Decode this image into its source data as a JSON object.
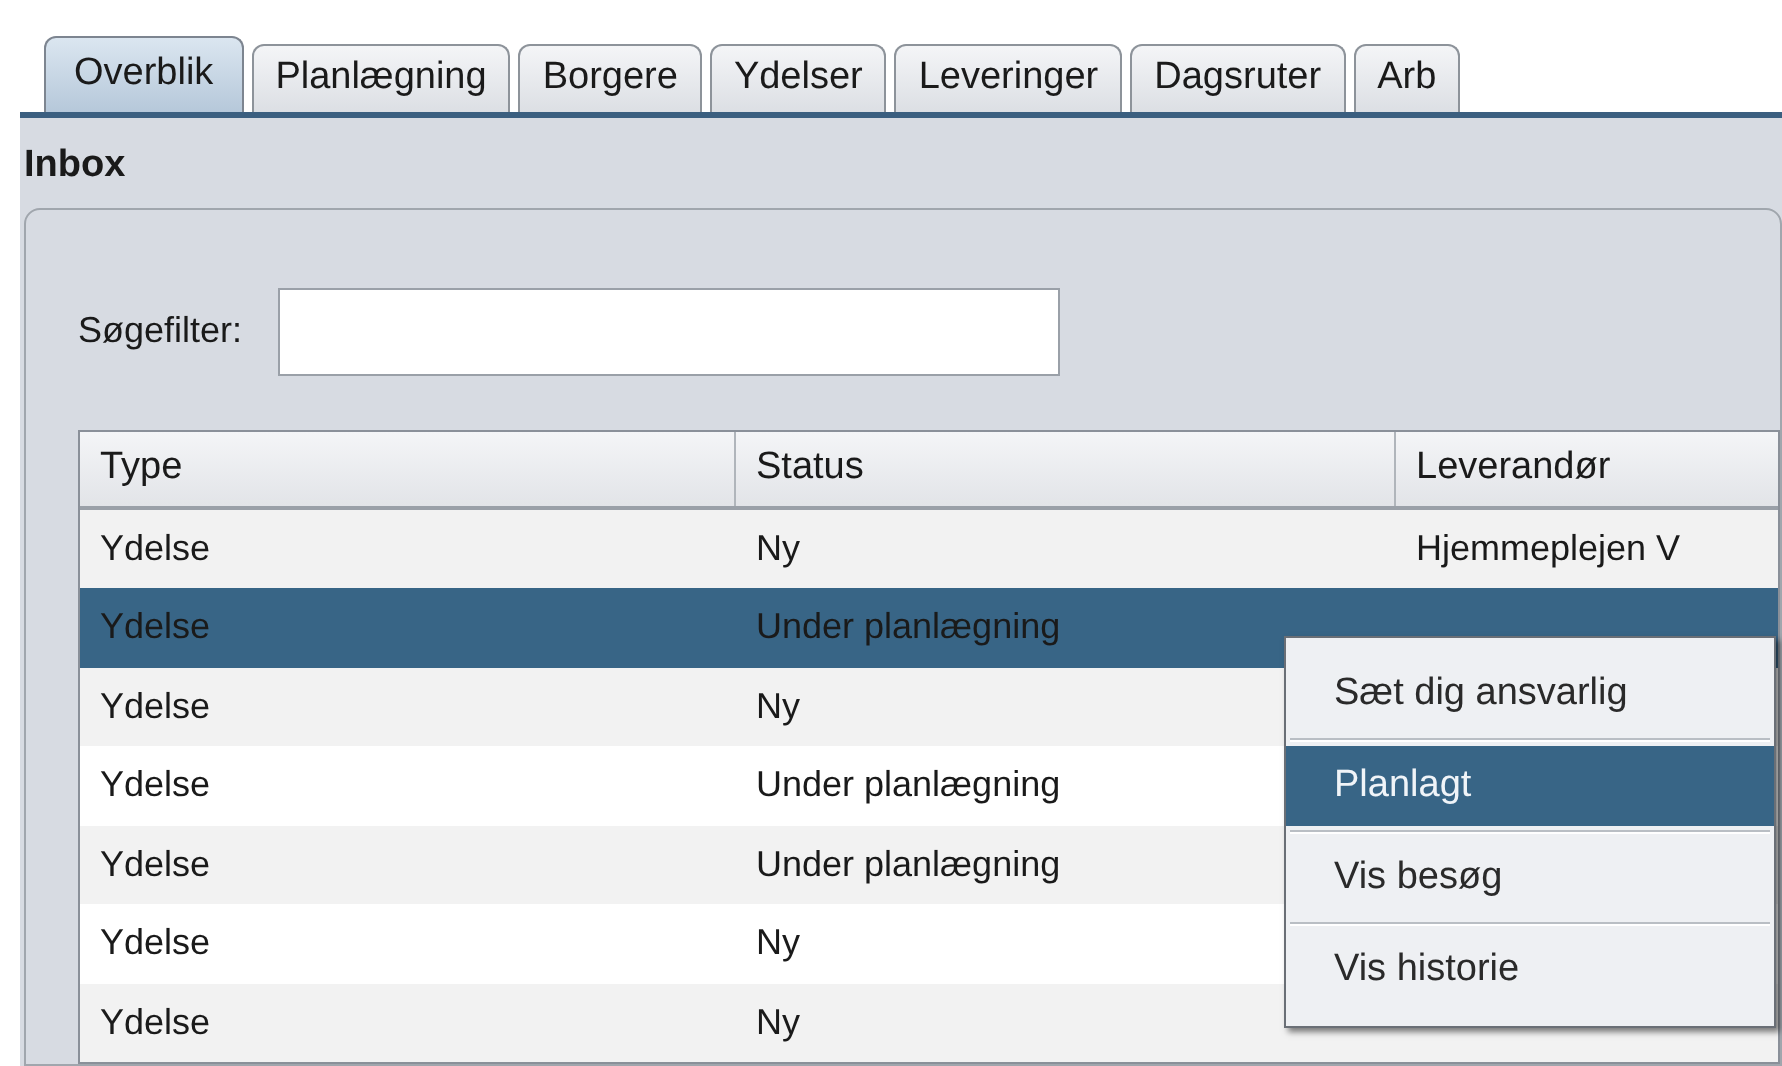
{
  "tabs": [
    {
      "label": "Overblik",
      "selected": true
    },
    {
      "label": "Planlægning",
      "selected": false
    },
    {
      "label": "Borgere",
      "selected": false
    },
    {
      "label": "Ydelser",
      "selected": false
    },
    {
      "label": "Leveringer",
      "selected": false
    },
    {
      "label": "Dagsruter",
      "selected": false
    },
    {
      "label": "Arb",
      "selected": false
    }
  ],
  "panel": {
    "title": "Inbox",
    "search": {
      "label": "Søgefilter:"
    }
  },
  "table": {
    "columns": [
      "Type",
      "Status",
      "Leverandør"
    ],
    "rows": [
      {
        "type": "Ydelse",
        "status": "Ny",
        "leverandor": "Hjemmeplejen V",
        "selected": false
      },
      {
        "type": "Ydelse",
        "status": "Under planlægning",
        "selected": true
      },
      {
        "type": "Ydelse",
        "status": "Ny",
        "selected": false
      },
      {
        "type": "Ydelse",
        "status": "Under planlægning",
        "selected": false
      },
      {
        "type": "Ydelse",
        "status": "Under planlægning",
        "selected": false
      },
      {
        "type": "Ydelse",
        "status": "Ny",
        "selected": false
      },
      {
        "type": "Ydelse",
        "status": "Ny",
        "selected": false
      }
    ]
  },
  "context_menu": {
    "items": [
      {
        "label": "Sæt dig ansvarlig",
        "selected": false
      },
      {
        "label": "Planlagt",
        "selected": true
      },
      {
        "label": "Vis besøg",
        "selected": false
      },
      {
        "label": "Vis historie",
        "selected": false
      }
    ]
  }
}
